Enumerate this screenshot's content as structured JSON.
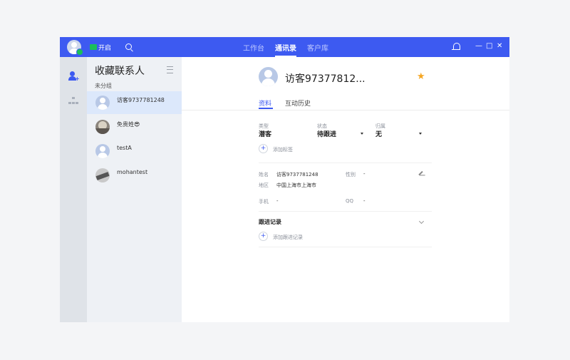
{
  "topbar": {
    "status_label": "开启",
    "nav": [
      "工作台",
      "通讯录",
      "客户库"
    ],
    "active_nav": "通讯录",
    "window_controls": [
      "—",
      "□",
      "✕"
    ]
  },
  "contacts": {
    "title": "收藏联系人",
    "group_label": "未分组",
    "items": [
      {
        "name": "访客9737781248",
        "selected": true
      },
      {
        "name": "免贵姓😎",
        "selected": false
      },
      {
        "name": "testA",
        "selected": false
      },
      {
        "name": "mohantest",
        "selected": false
      }
    ]
  },
  "profile": {
    "name": "访客97377812...",
    "tabs": [
      "资料",
      "互动历史"
    ],
    "active_tab": "资料",
    "type_label": "类型",
    "type_value": "潜客",
    "status_label": "状态",
    "status_value": "待跟进",
    "owner_label": "归属",
    "owner_value": "无",
    "add_tag": "添加标签",
    "fields": {
      "name_label": "姓名",
      "name_value": "访客9737781248",
      "gender_label": "性别",
      "gender_value": "-",
      "region_label": "地区",
      "region_value": "中国上海市上海市",
      "phone_label": "手机",
      "phone_value": "-",
      "qq_label": "QQ",
      "qq_value": "-"
    },
    "followup_title": "跟进记录",
    "add_followup": "添加跟进记录"
  },
  "colors": {
    "brand": "#3d5af1",
    "online": "#1bbf5a",
    "star": "#f5a623"
  }
}
